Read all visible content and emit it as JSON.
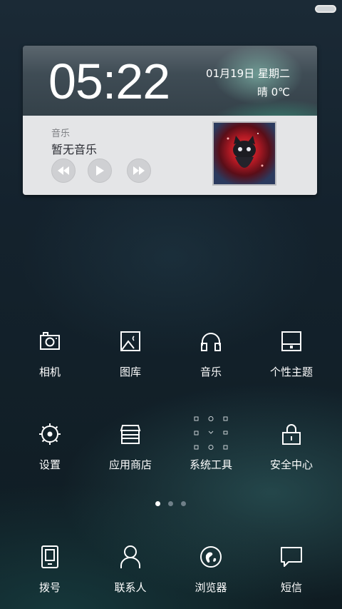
{
  "widget": {
    "time": "05:22",
    "date": "01月19日  星期二",
    "weather": "晴  0℃",
    "music": {
      "section_label": "音乐",
      "now_playing": "暂无音乐"
    }
  },
  "apps": [
    {
      "label": "相机",
      "icon": "camera-icon"
    },
    {
      "label": "图库",
      "icon": "gallery-icon"
    },
    {
      "label": "音乐",
      "icon": "headphones-icon"
    },
    {
      "label": "个性主题",
      "icon": "theme-icon"
    },
    {
      "label": "设置",
      "icon": "gear-icon"
    },
    {
      "label": "应用商店",
      "icon": "store-icon"
    },
    {
      "label": "系统工具",
      "icon": "tools-folder-icon"
    },
    {
      "label": "安全中心",
      "icon": "lock-icon"
    }
  ],
  "dock": [
    {
      "label": "拨号",
      "icon": "phone-icon"
    },
    {
      "label": "联系人",
      "icon": "contact-icon"
    },
    {
      "label": "浏览器",
      "icon": "browser-icon"
    },
    {
      "label": "短信",
      "icon": "message-icon"
    }
  ],
  "pager": {
    "pages": 3,
    "current": 1
  },
  "colors": {
    "text": "#ffffff",
    "widget_bottom": "#e4e5e7"
  }
}
